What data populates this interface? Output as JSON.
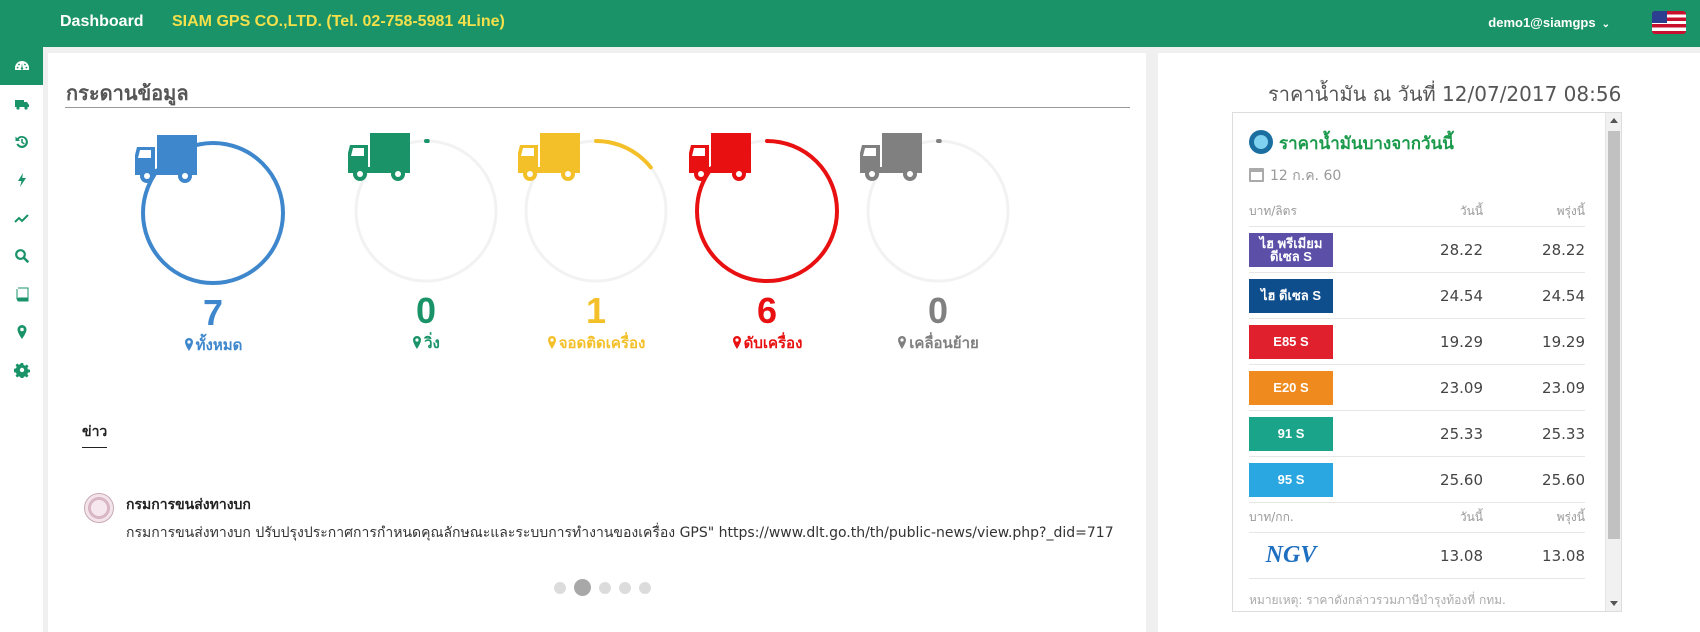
{
  "topbar": {
    "brand": "Dashboard",
    "company": "SIAM GPS CO.,LTD. (Tel. 02-758-5981 4Line)",
    "user": "demo1@siamgps",
    "flag_icon": "us-flag-icon"
  },
  "sidebar": {
    "items": [
      {
        "icon": "dashboard-icon",
        "active": true
      },
      {
        "icon": "truck-icon"
      },
      {
        "icon": "history-icon"
      },
      {
        "icon": "bolt-icon"
      },
      {
        "icon": "line-chart-icon"
      },
      {
        "icon": "search-icon"
      },
      {
        "icon": "book-icon"
      },
      {
        "icon": "map-marker-icon"
      },
      {
        "icon": "gear-icon"
      }
    ]
  },
  "main": {
    "heading": "กระดานข้อมูล",
    "stats": [
      {
        "value": "7",
        "label": "ทั้งหมด",
        "color": "#3f87cc",
        "fraction": 1.0
      },
      {
        "value": "0",
        "label": "วิ่ง",
        "color": "#1a9369",
        "fraction": 0.0
      },
      {
        "value": "1",
        "label": "จอดติดเครื่อง",
        "color": "#f4c02a",
        "fraction": 0.143
      },
      {
        "value": "6",
        "label": "ดับเครื่อง",
        "color": "#e81010",
        "fraction": 0.857
      },
      {
        "value": "0",
        "label": "เคลื่อนย้าย",
        "color": "#808080",
        "fraction": 0.0
      }
    ],
    "news_tab": "ข่าว",
    "news": {
      "title": "กรมการขนส่งทางบก",
      "body": "กรมการขนส่งทางบก ปรับปรุงประกาศการกำหนดคุณลักษณะและระบบการทำงานของเครื่อง GPS\" https://www.dlt.go.th/th/public-news/view.php?_did=717"
    },
    "pager": {
      "count": 5,
      "active": 1
    }
  },
  "oil": {
    "title": "ราคาน้ำมัน ณ วันที่ 12/07/2017 08:56",
    "bcp_title": "ราคาน้ำมันบางจากวันนี้",
    "bcp_date": "12 ก.ค. 60",
    "header1": {
      "unit": "บาท/ลิตร",
      "today": "วันนี้",
      "tomorrow": "พรุ่งนี้"
    },
    "fuels": [
      {
        "badge": "ไฮ พรีเมียม ดีเซล S",
        "color": "#5b4fa8",
        "today": "28.22",
        "tomorrow": "28.22"
      },
      {
        "badge": "ไฮ ดีเซล S",
        "color": "#0f4e8c",
        "today": "24.54",
        "tomorrow": "24.54"
      },
      {
        "badge": "E85 S",
        "color": "#e0202d",
        "today": "19.29",
        "tomorrow": "19.29"
      },
      {
        "badge": "E20 S",
        "color": "#ef8a1e",
        "today": "23.09",
        "tomorrow": "23.09"
      },
      {
        "badge": "91 S",
        "color": "#1aa58a",
        "today": "25.33",
        "tomorrow": "25.33"
      },
      {
        "badge": "95 S",
        "color": "#2aa6e0",
        "today": "25.60",
        "tomorrow": "25.60"
      }
    ],
    "header2": {
      "unit": "บาท/กก.",
      "today": "วันนี้",
      "tomorrow": "พรุ่งนี้"
    },
    "ngv": {
      "logo": "NGV",
      "today": "13.08",
      "tomorrow": "13.08"
    },
    "note": "หมายเหตุ: ราคาดังกล่าวรวมภาษีบำรุงท้องที่ กทม."
  }
}
